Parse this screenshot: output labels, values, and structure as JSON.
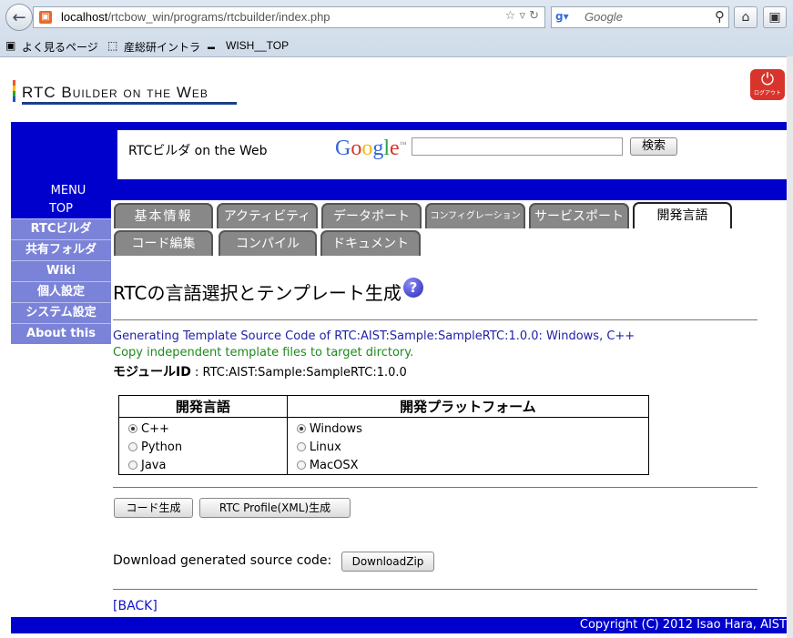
{
  "browser": {
    "url_host": "localhost",
    "url_path": "/rtcbow_win/programs/rtcbuilder/index.php",
    "search_engine": "Google",
    "bookmarks": [
      "よく見るページ",
      "産総研イントラ",
      "WISH__TOP"
    ]
  },
  "header": {
    "logo_text": "RTC Builder on the Web",
    "logout_label": "ログアウト",
    "site_title": "RTCビルダ on the Web",
    "google_logo": "Google",
    "search_button": "検索",
    "menu_label": "MENU"
  },
  "menu": {
    "top": "TOP",
    "items": [
      "RTCビルダ",
      "共有フォルダ",
      "Wiki",
      "個人設定",
      "システム設定",
      "About this"
    ]
  },
  "tabs": {
    "row1": [
      "基本情報",
      "アクティビティ",
      "データポート",
      "コンフィグレーション",
      "サービスポート",
      "開発言語"
    ],
    "row2": [
      "コード編集",
      "コンパイル",
      "ドキュメント"
    ],
    "active": "開発言語"
  },
  "main": {
    "heading": "RTCの言語選択とテンプレート生成",
    "message_generating": "Generating Template Source Code of RTC:AIST:Sample:SampleRTC:1.0.0: Windows, C++",
    "message_copy": "Copy independent template files to target dirctory.",
    "module_id_label": "モジュールID",
    "module_id_value": ": RTC:AIST:Sample:SampleRTC:1.0.0",
    "language_header": "開発言語",
    "platform_header": "開発プラットフォーム",
    "languages": [
      "C++",
      "Python",
      "Java"
    ],
    "selected_language": "C++",
    "platforms": [
      "Windows",
      "Linux",
      "MacOSX"
    ],
    "selected_platform": "Windows",
    "code_gen_button": "コード生成",
    "profile_button": "RTC Profile(XML)生成",
    "download_label": "Download generated source code:",
    "download_button": "DownloadZip",
    "back_link": "[BACK]"
  },
  "footer": {
    "copyright": "Copyright (C) 2012 Isao Hara, AIST"
  }
}
